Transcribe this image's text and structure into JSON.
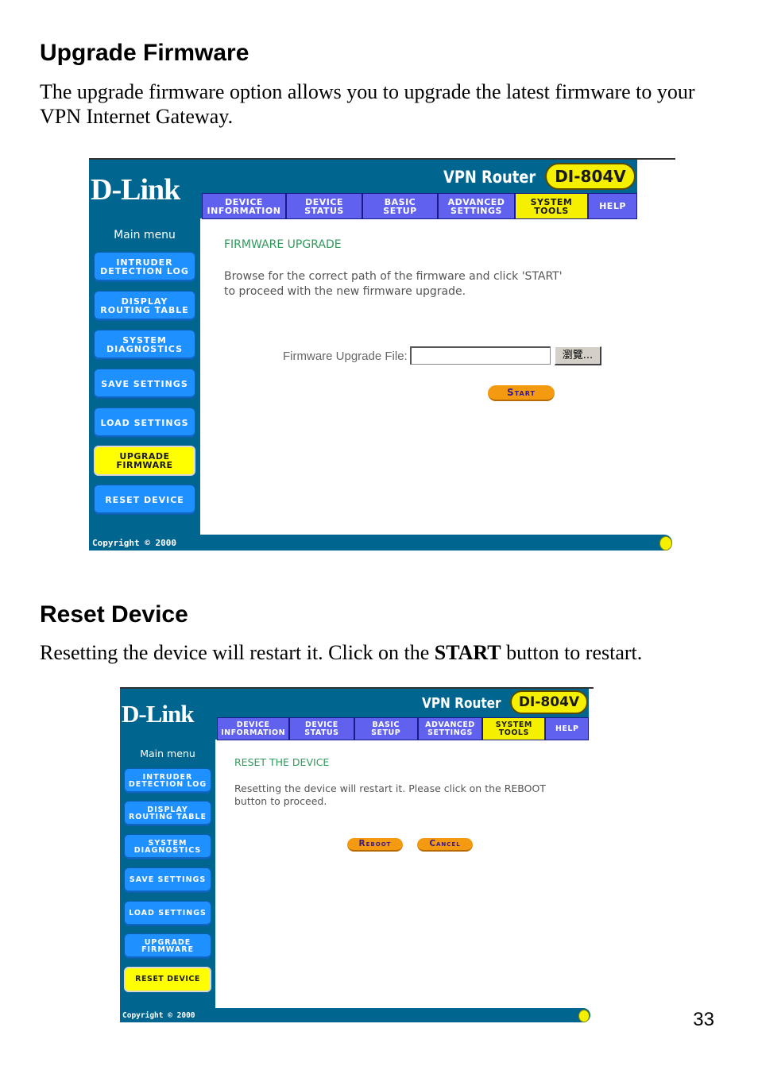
{
  "page_number": "33",
  "sections": [
    {
      "heading": "Upgrade Firmware",
      "body": "The upgrade firmware option allows you to upgrade the latest firmware to your VPN Internet Gateway."
    },
    {
      "heading": "Reset Device",
      "body_before": "Resetting the device will restart it. Click on the ",
      "body_bold": "START",
      "body_after": " button to restart."
    }
  ],
  "router_common": {
    "logo": "D-Link",
    "title": "VPN Router",
    "model": "DI-804V",
    "tabs": [
      {
        "line1": "DEVICE",
        "line2": "INFORMATION"
      },
      {
        "line1": "DEVICE",
        "line2": "STATUS"
      },
      {
        "line1": "BASIC",
        "line2": "SETUP"
      },
      {
        "line1": "ADVANCED",
        "line2": "SETTINGS"
      },
      {
        "line1": "SYSTEM",
        "line2": "TOOLS"
      },
      {
        "line1": "HELP",
        "line2": ""
      }
    ],
    "active_tab": "SYSTEM TOOLS",
    "main_menu_label": "Main menu",
    "menu": [
      {
        "line1": "INTRUDER",
        "line2": "DETECTION LOG"
      },
      {
        "line1": "DISPLAY",
        "line2": "ROUTING TABLE"
      },
      {
        "line1": "SYSTEM",
        "line2": "DIAGNOSTICS"
      },
      {
        "line1": "SAVE SETTINGS",
        "line2": ""
      },
      {
        "line1": "LOAD SETTINGS",
        "line2": ""
      },
      {
        "line1": "UPGRADE",
        "line2": "FIRMWARE"
      },
      {
        "line1": "RESET DEVICE",
        "line2": ""
      }
    ],
    "copyright": "Copyright © 2000",
    "colors": {
      "frame": "#00668f",
      "tab": "#6161f0",
      "active": "#f5f000",
      "menu_button": "#1e90ff",
      "section_title": "#2e9a5c",
      "action_button": "#f49a10"
    }
  },
  "screen1": {
    "active_menu": "UPGRADE FIRMWARE",
    "section_title": "FIRMWARE UPGRADE",
    "desc_line1": "Browse for the correct path of the firmware and click 'START'",
    "desc_line2": "to proceed with the new firmware upgrade.",
    "file_label": "Firmware Upgrade File:",
    "file_value": "",
    "browse_label": "瀏覽...",
    "start_label": "Start"
  },
  "screen2": {
    "active_menu": "RESET DEVICE",
    "section_title": "RESET THE DEVICE",
    "desc_line1": "Resetting the device will restart it. Please click on the REBOOT",
    "desc_line2": "button to proceed.",
    "reboot_label": "Reboot",
    "cancel_label": "Cancel"
  }
}
